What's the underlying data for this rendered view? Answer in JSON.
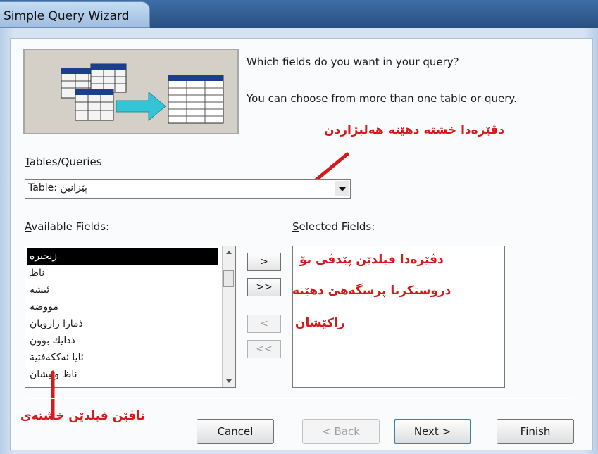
{
  "window": {
    "title": "Simple Query Wizard"
  },
  "instructions": {
    "line1": "Which fields do you want in your query?",
    "line2": "You can choose from more than one table or query."
  },
  "tables_queries": {
    "label_u": "T",
    "label_rest": "ables/Queries",
    "value": "Table: پێزانین"
  },
  "available": {
    "label_u": "A",
    "label_rest": "vailable Fields:",
    "items": [
      "زنجیرە",
      "ناظ",
      "ئیشە",
      "مووضە",
      "ذمارا زاروبان",
      "ذدایك بوون",
      "ئایا ئەككەفتیة",
      "ناظ ونیشان"
    ]
  },
  "selected": {
    "label_u": "S",
    "label_rest": "elected Fields:"
  },
  "move_buttons": {
    "add_one": ">",
    "add_all": ">>",
    "remove_one": "<",
    "remove_all": "<<"
  },
  "buttons": {
    "cancel": "Cancel",
    "back_u": "B",
    "back_pre": "< ",
    "back_rest": "ack",
    "next_u": "N",
    "next_rest": "ext >",
    "finish_u": "F",
    "finish_rest": "inish"
  },
  "annotations": {
    "table_choice": "دڤێرەدا خشتە دهێتە هەلبژاردن",
    "fields_source": "ناڤێن فیلدێن خشتەی",
    "selected_info_1": "دڤێرەدا فیلدێن پێدڤی بۆ",
    "selected_info_2": "دروستکرنا پرسگەهێ دهێنە",
    "selected_info_3": "راکێشان"
  },
  "colors": {
    "annotation": "#d41a1a",
    "list_selection": "#000000",
    "default_button_border": "#3c7fb1"
  },
  "icons": {
    "wizard_illustration": "tables-to-query-illustration",
    "combo_arrow": "chevron-down-icon"
  }
}
